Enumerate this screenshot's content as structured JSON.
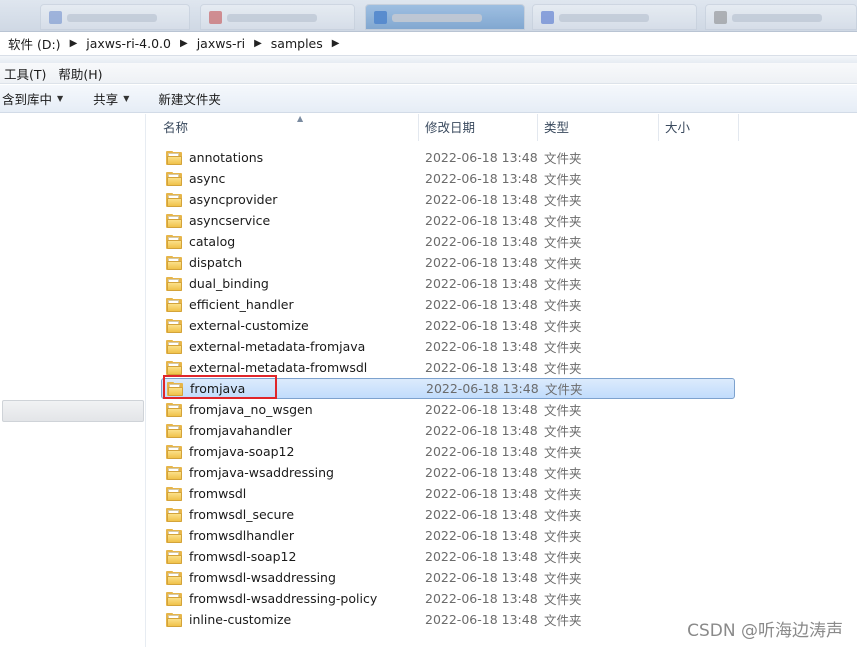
{
  "breadcrumb": [
    {
      "label": "软件 (D:)"
    },
    {
      "label": "jaxws-ri-4.0.0"
    },
    {
      "label": "jaxws-ri"
    },
    {
      "label": "samples"
    }
  ],
  "menubar": {
    "tools": "工具(T)",
    "help": "帮助(H)"
  },
  "toolbar": {
    "include_library": "含到库中",
    "share": "共享",
    "new_folder": "新建文件夹"
  },
  "columns": {
    "name": "名称",
    "date": "修改日期",
    "type": "类型",
    "size": "大小"
  },
  "files": [
    {
      "name": "annotations",
      "date": "2022-06-18 13:48",
      "type": "文件夹"
    },
    {
      "name": "async",
      "date": "2022-06-18 13:48",
      "type": "文件夹"
    },
    {
      "name": "asyncprovider",
      "date": "2022-06-18 13:48",
      "type": "文件夹"
    },
    {
      "name": "asyncservice",
      "date": "2022-06-18 13:48",
      "type": "文件夹"
    },
    {
      "name": "catalog",
      "date": "2022-06-18 13:48",
      "type": "文件夹"
    },
    {
      "name": "dispatch",
      "date": "2022-06-18 13:48",
      "type": "文件夹"
    },
    {
      "name": "dual_binding",
      "date": "2022-06-18 13:48",
      "type": "文件夹"
    },
    {
      "name": "efficient_handler",
      "date": "2022-06-18 13:48",
      "type": "文件夹"
    },
    {
      "name": "external-customize",
      "date": "2022-06-18 13:48",
      "type": "文件夹"
    },
    {
      "name": "external-metadata-fromjava",
      "date": "2022-06-18 13:48",
      "type": "文件夹"
    },
    {
      "name": "external-metadata-fromwsdl",
      "date": "2022-06-18 13:48",
      "type": "文件夹"
    },
    {
      "name": "fromjava",
      "date": "2022-06-18 13:48",
      "type": "文件夹",
      "selected": true
    },
    {
      "name": "fromjava_no_wsgen",
      "date": "2022-06-18 13:48",
      "type": "文件夹"
    },
    {
      "name": "fromjavahandler",
      "date": "2022-06-18 13:48",
      "type": "文件夹"
    },
    {
      "name": "fromjava-soap12",
      "date": "2022-06-18 13:48",
      "type": "文件夹"
    },
    {
      "name": "fromjava-wsaddressing",
      "date": "2022-06-18 13:48",
      "type": "文件夹"
    },
    {
      "name": "fromwsdl",
      "date": "2022-06-18 13:48",
      "type": "文件夹"
    },
    {
      "name": "fromwsdl_secure",
      "date": "2022-06-18 13:48",
      "type": "文件夹"
    },
    {
      "name": "fromwsdlhandler",
      "date": "2022-06-18 13:48",
      "type": "文件夹"
    },
    {
      "name": "fromwsdl-soap12",
      "date": "2022-06-18 13:48",
      "type": "文件夹"
    },
    {
      "name": "fromwsdl-wsaddressing",
      "date": "2022-06-18 13:48",
      "type": "文件夹"
    },
    {
      "name": "fromwsdl-wsaddressing-policy",
      "date": "2022-06-18 13:48",
      "type": "文件夹"
    },
    {
      "name": "inline-customize",
      "date": "2022-06-18 13:48",
      "type": "文件夹"
    }
  ],
  "watermark": "CSDN @听海边涛声",
  "colors": {
    "selection": "#c1dcfc",
    "highlight_box": "#e0262a",
    "folder": "#f0c24a"
  },
  "icons": {
    "folder": "folder-icon",
    "breadcrumb_sep": "chevron-right-icon",
    "dropdown": "caret-down-icon"
  }
}
